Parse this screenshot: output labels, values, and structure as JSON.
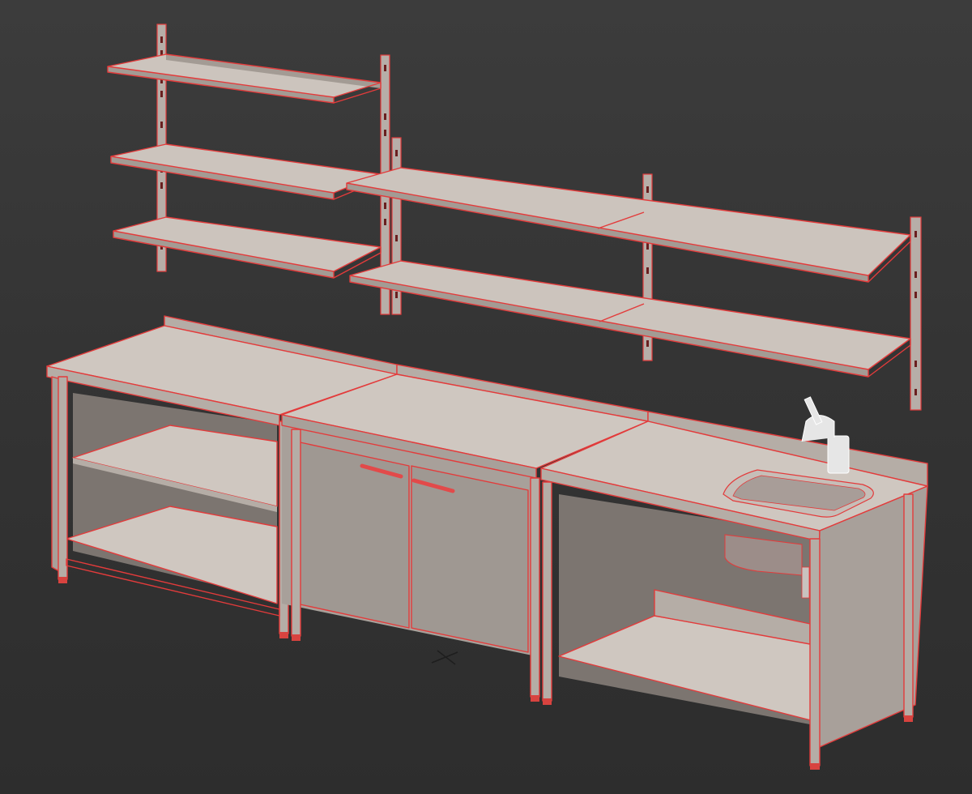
{
  "viewport": {
    "type": "3d-perspective-viewport",
    "display_mode": "shaded-with-edged-faces",
    "background_color": "#353535",
    "wireframe_color": "#e33b3b",
    "material_color": "#cfc7c0"
  },
  "scene": {
    "objects": [
      "wall-shelf-unit-left",
      "wall-shelf-unit-right",
      "open-table-left",
      "cabinet-table-center",
      "sink-table-right"
    ],
    "pivot_marker_icon": "transform-gizmo-icon"
  }
}
